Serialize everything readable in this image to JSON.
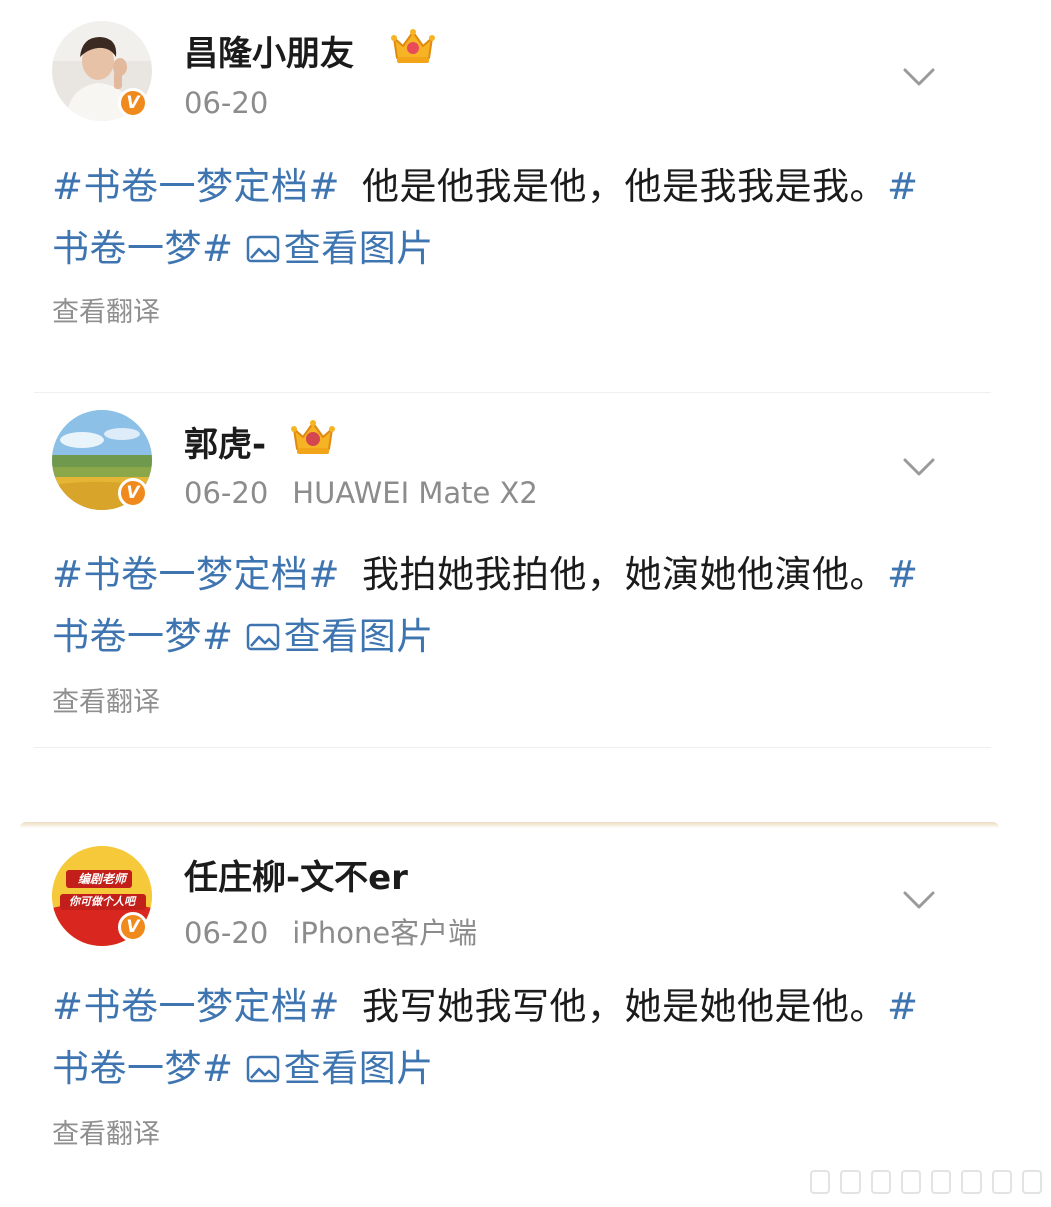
{
  "posts": [
    {
      "username": "昌隆小朋友",
      "date": "06-20",
      "source": "",
      "verified_badge": "V",
      "crown_icon": "crown-icon",
      "topic_a": "#书卷一梦定档#",
      "text": "他是他我是他，他是我我是我。",
      "topic_b_start": "#",
      "topic_b_end": "书卷一梦#",
      "view_pictures": "查看图片",
      "translate": "查看翻译"
    },
    {
      "username": "郭虎-",
      "date": "06-20",
      "source": "HUAWEI Mate X2",
      "verified_badge": "V",
      "crown_icon": "crown-icon",
      "topic_a": "#书卷一梦定档#",
      "text": "我拍她我拍他，她演她他演他。",
      "topic_b_start": "#",
      "topic_b_end": "书卷一梦#",
      "view_pictures": "查看图片",
      "translate": "查看翻译"
    },
    {
      "username": "任庄柳-文不er",
      "date": "06-20",
      "source": "iPhone客户端",
      "verified_badge": "V",
      "avatar_text_1": "编剧老师",
      "avatar_text_2": "你可做个人吧",
      "topic_a": "#书卷一梦定档#",
      "text": "我写她我写他，她是她他是他。",
      "topic_b_start": "#",
      "topic_b_end": "书卷一梦#",
      "view_pictures": "查看图片",
      "translate": "查看翻译"
    }
  ],
  "colors": {
    "topic_link": "#3e75b0",
    "meta_gray": "#8c8c8c",
    "badge_orange": "#f08a1c",
    "text": "#1b1b1b"
  }
}
